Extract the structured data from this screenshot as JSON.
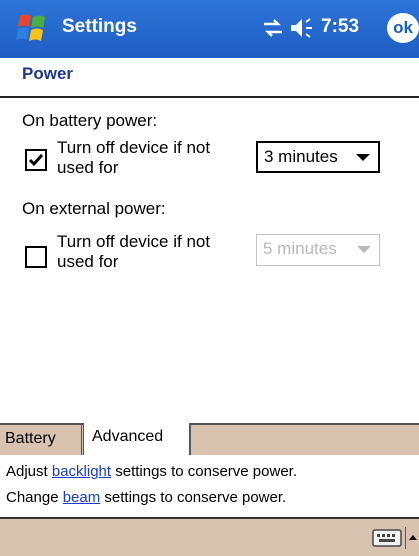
{
  "titlebar": {
    "app_title": "Settings",
    "time": "7:53",
    "ok_label": "ok",
    "start_icon": "windows-flag-icon",
    "connectivity_icon": "connectivity-icon",
    "volume_icon": "speaker-icon",
    "background_color": "#1d5ec3"
  },
  "page": {
    "title": "Power",
    "title_color": "#1d3a8a"
  },
  "battery": {
    "section_label": "On battery power:",
    "option_line1": "Turn off device if not",
    "option_line2": "used for",
    "checked": true,
    "dropdown_value": "3 minutes"
  },
  "external": {
    "section_label": "On external power:",
    "option_line1": "Turn off device if not",
    "option_line2": "used for",
    "checked": false,
    "dropdown_value": "5 minutes",
    "dropdown_enabled": false
  },
  "tabs": [
    {
      "label": "Battery",
      "active": false
    },
    {
      "label": "Advanced",
      "active": true
    }
  ],
  "info": {
    "line1_prefix": "Adjust ",
    "line1_link": "backlight",
    "line1_suffix": " settings to conserve power.",
    "line2_prefix": "Change ",
    "line2_link": "beam",
    "line2_suffix": " settings to conserve power.",
    "link_color": "#1a3fd0"
  },
  "bottom_bar": {
    "keyboard_icon": "keyboard-icon",
    "sip_arrow_icon": "up-arrow-icon",
    "background_color": "#d8c2b0"
  }
}
